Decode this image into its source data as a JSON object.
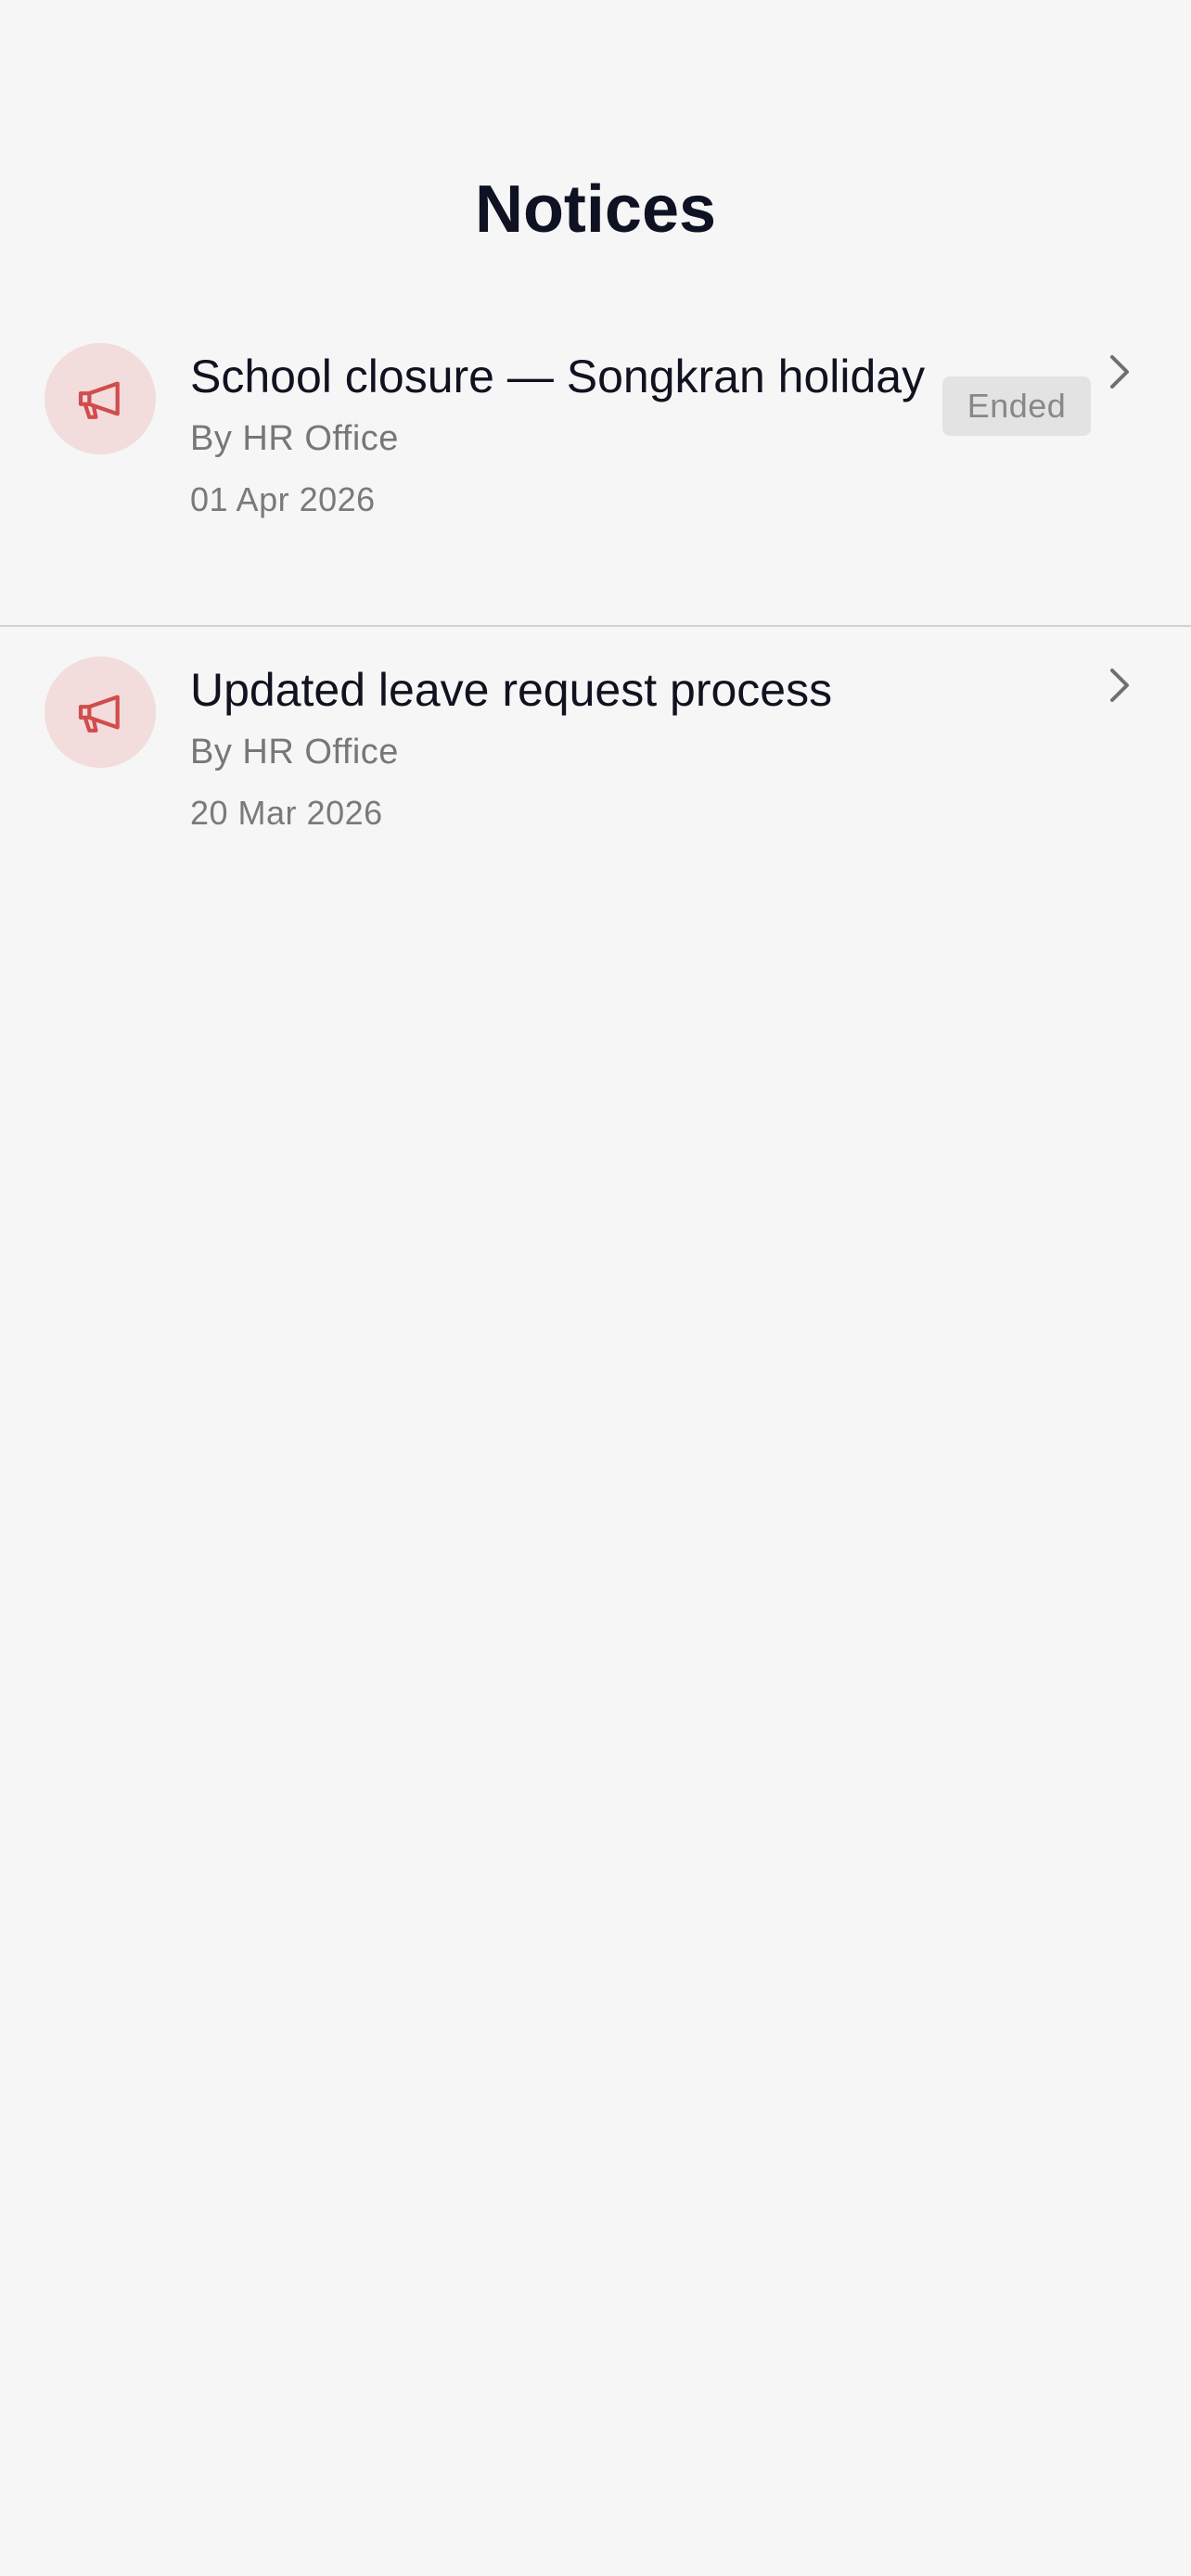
{
  "header": {
    "title": "Notices"
  },
  "notices": [
    {
      "title": "School closure — Songkran holiday",
      "author": "By HR Office",
      "date": "01 Apr 2026",
      "status": "Ended",
      "icon": "megaphone-icon"
    },
    {
      "title": "Updated leave request process",
      "author": "By HR Office",
      "date": "20 Mar 2026",
      "icon": "megaphone-icon"
    }
  ],
  "colors": {
    "background": "#f6f6f6",
    "icon_accent": "#d24c4c",
    "icon_bg": "#f2dcdc",
    "badge_bg": "#e3e3e3",
    "divider": "#d2d2d2"
  }
}
